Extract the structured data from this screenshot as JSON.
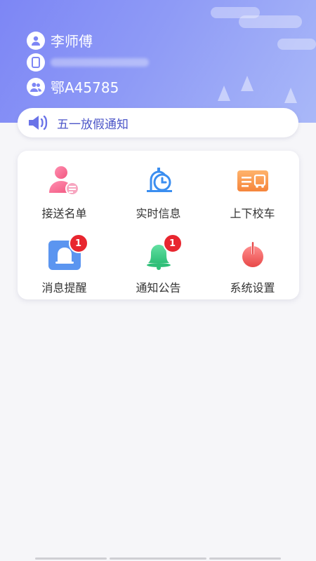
{
  "header": {
    "driver_name": "李师傅",
    "phone": "",
    "plate": "鄂A45785"
  },
  "notice": {
    "text": "五一放假通知"
  },
  "menu": [
    {
      "label": "接送名单",
      "icon": "pickup-list-icon",
      "badge": ""
    },
    {
      "label": "实时信息",
      "icon": "realtime-clock-icon",
      "badge": ""
    },
    {
      "label": "上下校车",
      "icon": "bus-card-icon",
      "badge": ""
    },
    {
      "label": "消息提醒",
      "icon": "message-bell-icon",
      "badge": "1"
    },
    {
      "label": "通知公告",
      "icon": "announcement-bell-icon",
      "badge": "1"
    },
    {
      "label": "系统设置",
      "icon": "power-settings-icon",
      "badge": ""
    }
  ],
  "colors": {
    "accent": "#4c56c8",
    "header_gradient_start": "#7d86f5",
    "header_gradient_end": "#a9b8f8",
    "badge": "#e8262f"
  }
}
